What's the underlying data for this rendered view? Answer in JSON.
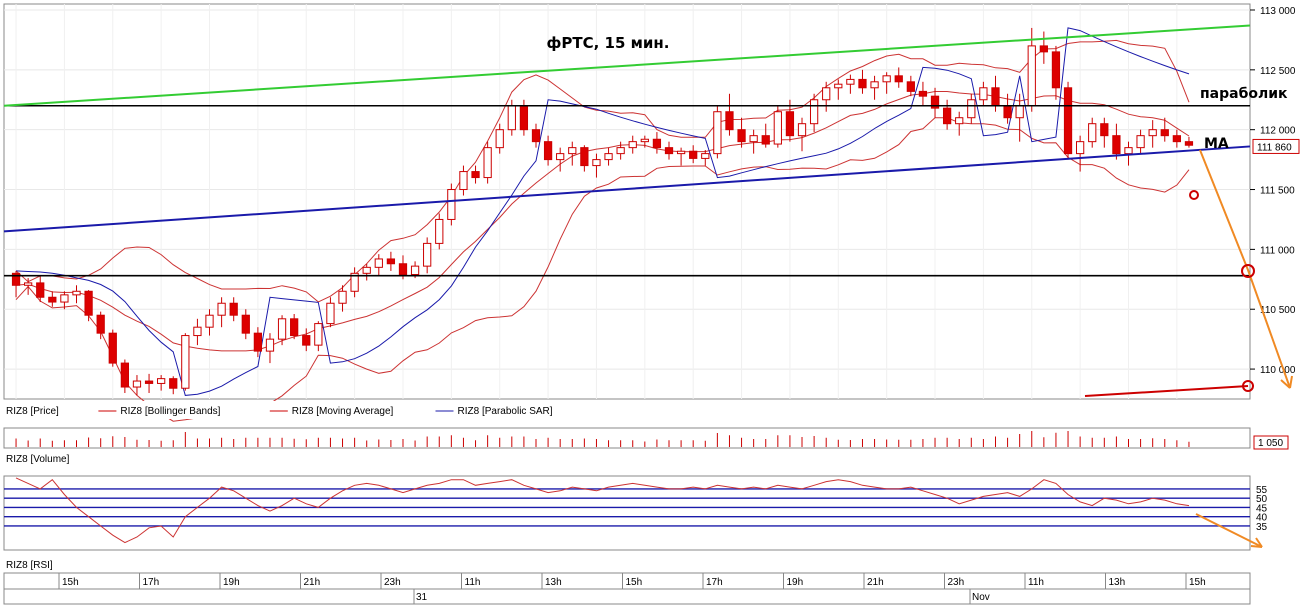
{
  "chart_data": {
    "type": "candlestick",
    "title": "фРТС, 15 мин.",
    "annotations": {
      "sar_label": "параболик",
      "ma_label": "MA"
    },
    "price_panel": {
      "legend": [
        {
          "name": "RIZ8 [Price]",
          "color": "#000000"
        },
        {
          "name": "RIZ8 [Bollinger Bands]",
          "color": "#cc0000"
        },
        {
          "name": "RIZ8 [Moving Average]",
          "color": "#cc0000"
        },
        {
          "name": "RIZ8 [Parabolic SAR]",
          "color": "#1a1aaa"
        }
      ],
      "ylim": [
        109750,
        113050
      ],
      "yticks": [
        {
          "v": 113000,
          "label": "113 000"
        },
        {
          "v": 112500,
          "label": "112 500"
        },
        {
          "v": 112000,
          "label": "112 000"
        },
        {
          "v": 111500,
          "label": "111 500"
        },
        {
          "v": 111000,
          "label": "111 000"
        },
        {
          "v": 110500,
          "label": "110 500"
        },
        {
          "v": 110000,
          "label": "110 000"
        }
      ],
      "last_price": {
        "value": 111860,
        "label": "111 860"
      },
      "horizontal_levels": [
        112200,
        110780
      ],
      "channel_lines": [
        {
          "name": "upper-trend",
          "color": "#33cc33",
          "from": 112200,
          "to": 112870
        },
        {
          "name": "lower-trend",
          "color": "#1a1aaa",
          "from": 111150,
          "to": 111860
        }
      ],
      "candles": [
        [
          110800,
          110820,
          110600,
          110700
        ],
        [
          110700,
          110760,
          110620,
          110720
        ],
        [
          110720,
          110780,
          110560,
          110600
        ],
        [
          110600,
          110650,
          110520,
          110560
        ],
        [
          110560,
          110650,
          110500,
          110620
        ],
        [
          110620,
          110700,
          110550,
          110650
        ],
        [
          110650,
          110660,
          110400,
          110450
        ],
        [
          110450,
          110480,
          110250,
          110300
        ],
        [
          110300,
          110330,
          110020,
          110050
        ],
        [
          110050,
          110080,
          109800,
          109850
        ],
        [
          109850,
          109950,
          109780,
          109900
        ],
        [
          109900,
          109960,
          109800,
          109880
        ],
        [
          109880,
          109950,
          109820,
          109920
        ],
        [
          109920,
          109940,
          109790,
          109840
        ],
        [
          109840,
          110300,
          109820,
          110280
        ],
        [
          110280,
          110420,
          110200,
          110350
        ],
        [
          110350,
          110500,
          110280,
          110450
        ],
        [
          110450,
          110600,
          110350,
          110550
        ],
        [
          110550,
          110600,
          110400,
          110450
        ],
        [
          110450,
          110500,
          110250,
          110300
        ],
        [
          110300,
          110350,
          110100,
          110150
        ],
        [
          110150,
          110300,
          110050,
          110250
        ],
        [
          110250,
          110450,
          110200,
          110420
        ],
        [
          110420,
          110460,
          110250,
          110280
        ],
        [
          110280,
          110340,
          110150,
          110200
        ],
        [
          110200,
          110400,
          110150,
          110380
        ],
        [
          110380,
          110600,
          110350,
          110550
        ],
        [
          110550,
          110700,
          110480,
          110650
        ],
        [
          110650,
          110850,
          110600,
          110800
        ],
        [
          110800,
          110880,
          110740,
          110850
        ],
        [
          110850,
          110960,
          110780,
          110920
        ],
        [
          110920,
          110980,
          110820,
          110880
        ],
        [
          110880,
          110950,
          110750,
          110790
        ],
        [
          110790,
          110900,
          110760,
          110860
        ],
        [
          110860,
          111100,
          110800,
          111050
        ],
        [
          111050,
          111300,
          111000,
          111250
        ],
        [
          111250,
          111550,
          111200,
          111500
        ],
        [
          111500,
          111700,
          111450,
          111650
        ],
        [
          111650,
          111700,
          111550,
          111600
        ],
        [
          111600,
          111900,
          111550,
          111850
        ],
        [
          111850,
          112050,
          111800,
          112000
        ],
        [
          112000,
          112250,
          111950,
          112200
        ],
        [
          112200,
          112250,
          111950,
          112000
        ],
        [
          112000,
          112050,
          111850,
          111900
        ],
        [
          111900,
          111950,
          111700,
          111750
        ],
        [
          111750,
          111850,
          111650,
          111800
        ],
        [
          111800,
          111900,
          111700,
          111850
        ],
        [
          111850,
          111870,
          111650,
          111700
        ],
        [
          111700,
          111800,
          111600,
          111750
        ],
        [
          111750,
          111850,
          111700,
          111800
        ],
        [
          111800,
          111900,
          111750,
          111850
        ],
        [
          111850,
          111950,
          111800,
          111900
        ],
        [
          111900,
          111950,
          111850,
          111920
        ],
        [
          111920,
          111980,
          111800,
          111850
        ],
        [
          111850,
          111900,
          111750,
          111800
        ],
        [
          111800,
          111850,
          111700,
          111820
        ],
        [
          111820,
          111870,
          111720,
          111760
        ],
        [
          111760,
          111830,
          111700,
          111800
        ],
        [
          111800,
          112200,
          111760,
          112150
        ],
        [
          112150,
          112300,
          111950,
          112000
        ],
        [
          112000,
          112100,
          111850,
          111900
        ],
        [
          111900,
          112000,
          111800,
          111950
        ],
        [
          111950,
          112050,
          111850,
          111880
        ],
        [
          111880,
          112200,
          111850,
          112150
        ],
        [
          112150,
          112250,
          111900,
          111950
        ],
        [
          111950,
          112100,
          111820,
          112050
        ],
        [
          112050,
          112300,
          111980,
          112250
        ],
        [
          112250,
          112400,
          112150,
          112350
        ],
        [
          112350,
          112420,
          112250,
          112380
        ],
        [
          112380,
          112460,
          112300,
          112420
        ],
        [
          112420,
          112500,
          112300,
          112350
        ],
        [
          112350,
          112450,
          112250,
          112400
        ],
        [
          112400,
          112480,
          112300,
          112450
        ],
        [
          112450,
          112520,
          112350,
          112400
        ],
        [
          112400,
          112450,
          112280,
          112320
        ],
        [
          112320,
          112400,
          112200,
          112280
        ],
        [
          112280,
          112350,
          112100,
          112180
        ],
        [
          112180,
          112250,
          112000,
          112050
        ],
        [
          112050,
          112150,
          111950,
          112100
        ],
        [
          112100,
          112300,
          112050,
          112250
        ],
        [
          112250,
          112400,
          112200,
          112350
        ],
        [
          112350,
          112450,
          112150,
          112200
        ],
        [
          112200,
          112300,
          112050,
          112100
        ],
        [
          112100,
          112300,
          111900,
          112200
        ],
        [
          112200,
          112850,
          112150,
          112700
        ],
        [
          112700,
          112820,
          112550,
          112650
        ],
        [
          112650,
          112700,
          112250,
          112350
        ],
        [
          112350,
          112400,
          111750,
          111800
        ],
        [
          111800,
          111950,
          111650,
          111900
        ],
        [
          111900,
          112100,
          111850,
          112050
        ],
        [
          112050,
          112100,
          111850,
          111950
        ],
        [
          111950,
          112050,
          111750,
          111800
        ],
        [
          111800,
          111900,
          111700,
          111850
        ],
        [
          111850,
          112000,
          111800,
          111950
        ],
        [
          111950,
          112080,
          111850,
          112000
        ],
        [
          112000,
          112100,
          111900,
          111950
        ],
        [
          111950,
          112000,
          111850,
          111900
        ],
        [
          111900,
          111940,
          111850,
          111870
        ]
      ]
    },
    "volume_panel": {
      "name": "RIZ8 [Volume]",
      "last_label": "1 050"
    },
    "rsi_panel": {
      "name": "RIZ8 [RSI]",
      "ylim": [
        22,
        62
      ],
      "levels": [
        55,
        50,
        45,
        40,
        35
      ],
      "yticks": [
        {
          "v": 55,
          "label": "55"
        },
        {
          "v": 50,
          "label": "50"
        },
        {
          "v": 45,
          "label": "45"
        },
        {
          "v": 40,
          "label": "40"
        },
        {
          "v": 35,
          "label": "35"
        }
      ],
      "values": [
        61,
        58,
        55,
        60,
        52,
        45,
        40,
        35,
        30,
        26,
        29,
        34,
        35,
        29,
        40,
        45,
        50,
        56,
        54,
        50,
        46,
        43,
        46,
        50,
        47,
        45,
        50,
        54,
        57,
        58,
        57,
        55,
        53,
        55,
        57,
        58,
        60,
        60,
        57,
        58,
        59,
        60,
        57,
        55,
        53,
        54,
        56,
        55,
        54,
        56,
        57,
        58,
        57,
        56,
        55,
        55,
        56,
        55,
        57,
        56,
        55,
        56,
        55,
        57,
        56,
        55,
        57,
        59,
        60,
        59,
        57,
        56,
        55,
        55,
        56,
        54,
        52,
        50,
        47,
        49,
        51,
        52,
        53,
        51,
        55,
        60,
        58,
        52,
        48,
        46,
        50,
        49,
        47,
        48,
        50,
        49,
        47,
        46
      ]
    },
    "time_axis": {
      "hour_labels": [
        "15h",
        "17h",
        "19h",
        "21h",
        "23h",
        "11h",
        "13h",
        "15h",
        "17h",
        "19h",
        "21h",
        "23h",
        "11h",
        "13h",
        "15h"
      ],
      "day_labels": [
        "31",
        "Nov"
      ]
    }
  }
}
